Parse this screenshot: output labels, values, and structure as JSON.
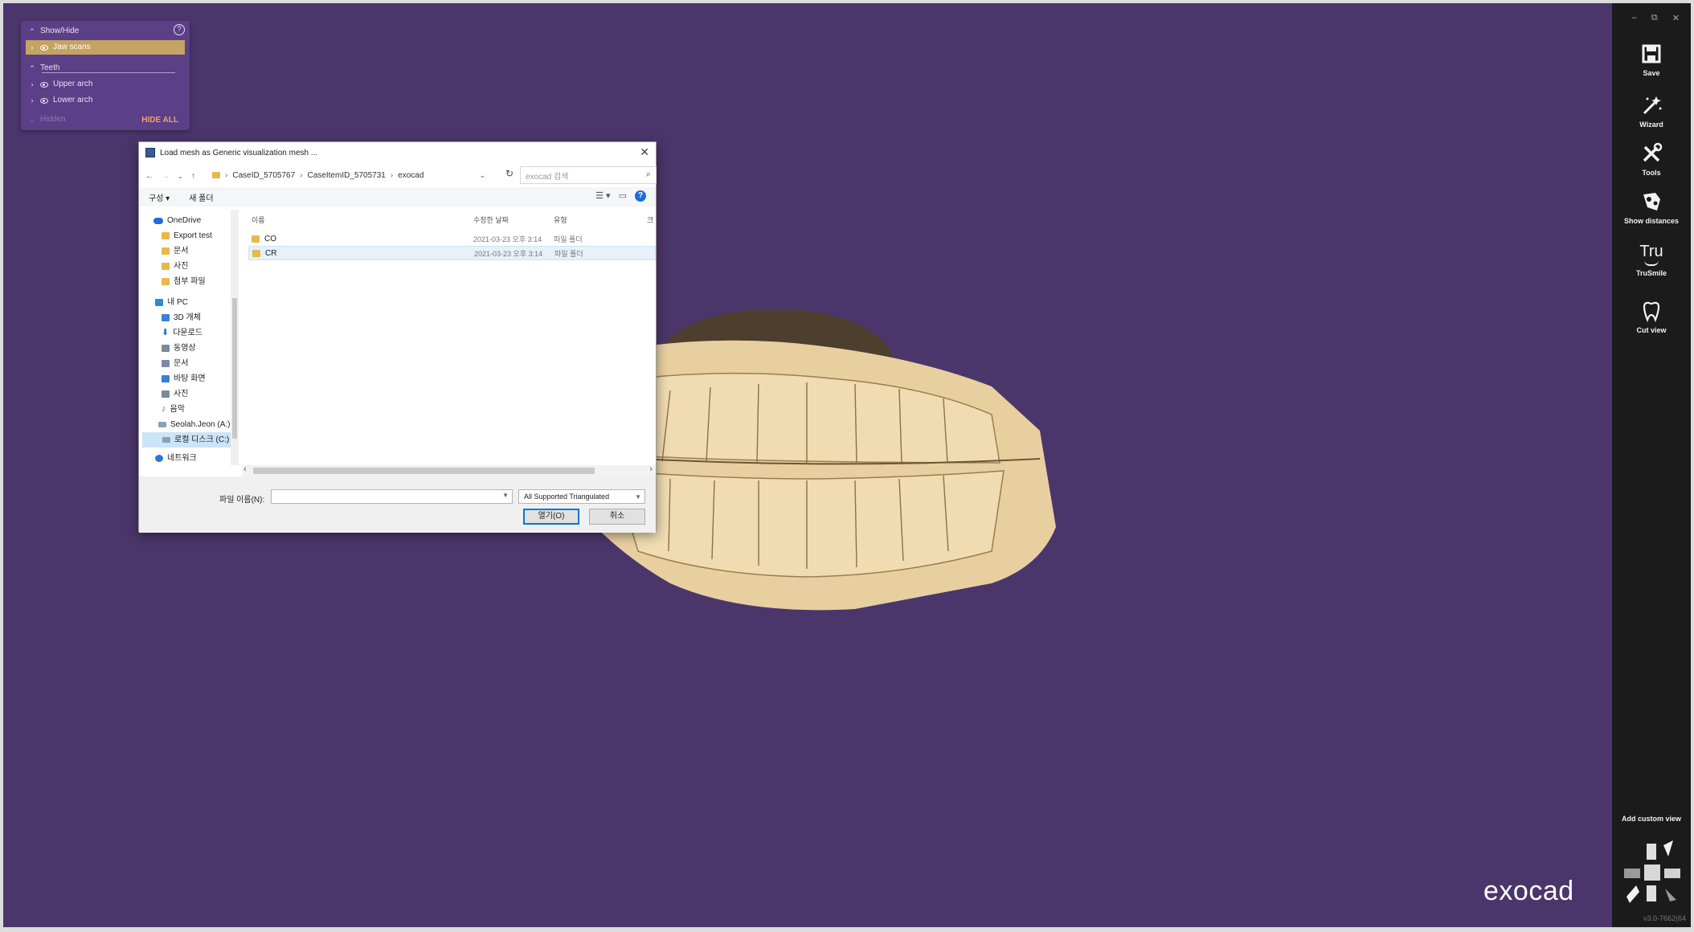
{
  "show_hide": {
    "title": "Show/Hide",
    "rows": [
      {
        "label": "Jaw scans",
        "selected": true
      },
      {
        "label": "Teeth",
        "selected": false
      },
      {
        "label": "Upper arch",
        "selected": false
      },
      {
        "label": "Lower arch",
        "selected": false
      }
    ],
    "hidden_label": "Hidden",
    "hide_all_label": "HIDE ALL"
  },
  "dialog": {
    "title": "Load mesh as Generic visualization mesh ...",
    "breadcrumb": [
      "CaseID_5705767",
      "CaseItemID_5705731",
      "exocad"
    ],
    "search_placeholder": "exocad 검색",
    "toolbar": {
      "organize": "구성 ▾",
      "new_folder": "새 폴더",
      "help": "?"
    },
    "nav": [
      {
        "label": "OneDrive",
        "icon": "cloud-icon"
      },
      {
        "label": "Export test",
        "icon": "folder-icon"
      },
      {
        "label": "문서",
        "icon": "folder-icon"
      },
      {
        "label": "사진",
        "icon": "folder-icon"
      },
      {
        "label": "첨부 파일",
        "icon": "folder-icon"
      },
      {
        "label": "내 PC",
        "icon": "pc-icon"
      },
      {
        "label": "3D 개체",
        "icon": "3d-objects-icon"
      },
      {
        "label": "다운로드",
        "icon": "download-icon"
      },
      {
        "label": "동영상",
        "icon": "video-icon"
      },
      {
        "label": "문서",
        "icon": "document-icon"
      },
      {
        "label": "바탕 화면",
        "icon": "desktop-icon"
      },
      {
        "label": "사진",
        "icon": "pictures-icon"
      },
      {
        "label": "음악",
        "icon": "music-icon"
      },
      {
        "label": "Seolah.Jeon (A:)",
        "icon": "network-drive-icon"
      },
      {
        "label": "로컬 디스크 (C:)",
        "icon": "drive-icon"
      },
      {
        "label": "네트워크",
        "icon": "network-icon"
      }
    ],
    "columns": {
      "name": "이름",
      "modified": "수정한 날짜",
      "type": "유형",
      "extra": "크"
    },
    "files": [
      {
        "name": "CO",
        "modified": "2021-03-23 오후 3:14",
        "type": "파일 폴더"
      },
      {
        "name": "CR",
        "modified": "2021-03-23 오후 3:14",
        "type": "파일 폴더"
      }
    ],
    "filename_label": "파일 이름(N):",
    "filename_value": "",
    "filetype_value": "All Supported Triangulated",
    "open_button": "열기(O)",
    "cancel_button": "취소"
  },
  "right_toolbar": {
    "items": [
      {
        "label": "Save",
        "icon": "save-icon"
      },
      {
        "label": "Wizard",
        "icon": "wizard-icon"
      },
      {
        "label": "Tools",
        "icon": "tools-icon"
      },
      {
        "label": "Show distances",
        "icon": "show-distances-icon"
      },
      {
        "label": "TruSmile",
        "icon": "trusmile-icon",
        "glyph": "Tru"
      },
      {
        "label": "Cut view",
        "icon": "cut-view-icon"
      }
    ],
    "add_custom_view": "Add custom view",
    "version": "v3.0-7662(64"
  },
  "brand": "exocad",
  "colors": {
    "viewport": "#4b366c",
    "panel": "#5b3f87",
    "selected_row": "#c5a363",
    "hide_all": "#f0a26a",
    "toolbar_bg": "#1b1b1b"
  }
}
